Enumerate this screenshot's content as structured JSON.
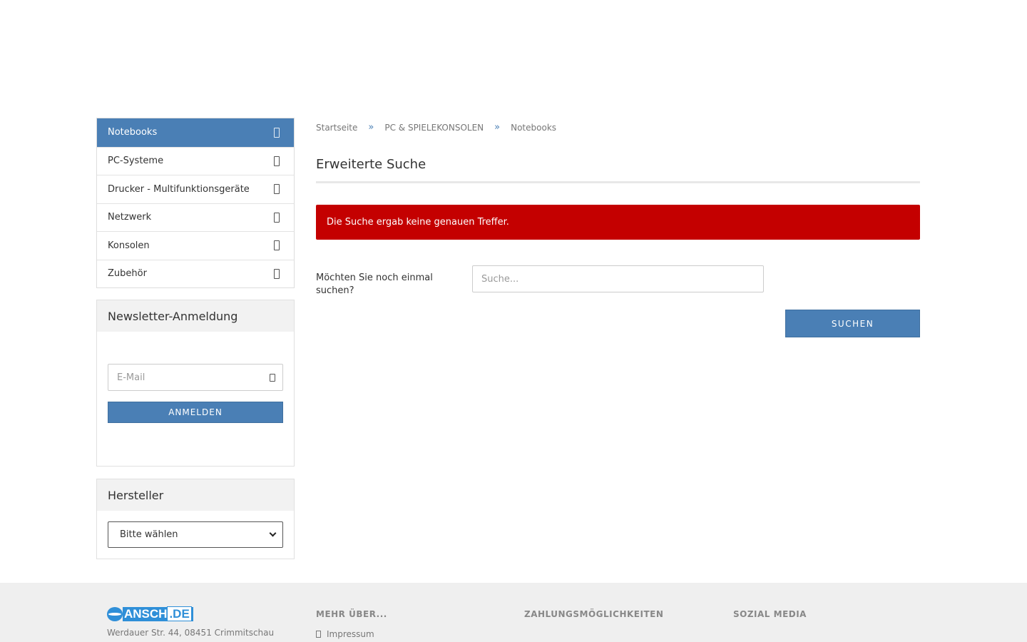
{
  "sidebar": {
    "categories": [
      {
        "label": "Notebooks",
        "active": true
      },
      {
        "label": "PC-Systeme"
      },
      {
        "label": "Drucker - Multifunktionsgeräte"
      },
      {
        "label": "Netzwerk"
      },
      {
        "label": "Konsolen"
      },
      {
        "label": "Zubehör"
      }
    ],
    "newsletter": {
      "title": "Newsletter-Anmeldung",
      "email_placeholder": "E-Mail",
      "submit_label": "ANMELDEN"
    },
    "manufacturer": {
      "title": "Hersteller",
      "selected": "Bitte wählen"
    }
  },
  "breadcrumb": {
    "items": [
      "Startseite",
      "PC & SPIELEKONSOLEN",
      "Notebooks"
    ],
    "separator": "»"
  },
  "main": {
    "title": "Erweiterte Suche",
    "alert": "Die Suche ergab keine genauen Treffer.",
    "search_label": "Möchten Sie noch einmal suchen?",
    "search_placeholder": "Suche...",
    "search_button": "SUCHEN"
  },
  "footer": {
    "logo_text": "ANSCH",
    "logo_tld": ".DE",
    "address": "Werdauer Str. 44, 08451 Crimmitschau",
    "col_more": "MEHR ÜBER...",
    "col_payment": "ZAHLUNGSMÖGLICHKEITEN",
    "col_social": "SOZIAL MEDIA",
    "impressum": "Impressum"
  },
  "colors": {
    "accent": "#4a7fb5",
    "alert": "#c40000",
    "footer_bg": "#efefef",
    "logo_blue": "#2f8fd8"
  }
}
